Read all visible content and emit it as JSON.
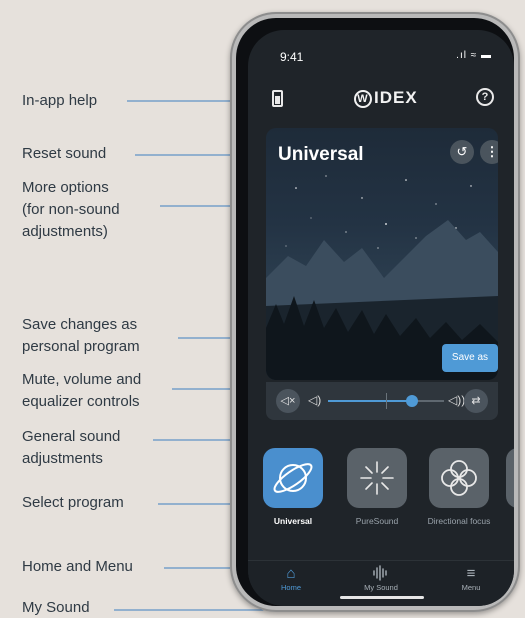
{
  "annotations": {
    "in_app_help": "In-app help",
    "reset_sound": "Reset sound",
    "more_options_1": "More options",
    "more_options_2": "(for non-sound",
    "more_options_3": "adjustments)",
    "save_changes_1": "Save changes as",
    "save_changes_2": "personal program",
    "mute_volume_1": "Mute, volume and",
    "mute_volume_2": "equalizer controls",
    "general_sound_1": "General sound",
    "general_sound_2": "adjustments",
    "select_program": "Select program",
    "home_menu": "Home and Menu",
    "my_sound": "My Sound"
  },
  "status_bar": {
    "time": "9:41",
    "signal": ".ıl ≈ ▬"
  },
  "app_bar": {
    "brand_mark": "W",
    "brand_text": "IDEX",
    "help_glyph": "?"
  },
  "program_card": {
    "title": "Universal",
    "reset_glyph": "↺",
    "more_glyph": "⋮",
    "save_label": "Save as"
  },
  "volume": {
    "mute_glyph": "◁×",
    "low_glyph": "◁)",
    "high_glyph": "◁))",
    "eq_glyph": "⇄",
    "level": 0.72
  },
  "programs": [
    {
      "label": "Universal",
      "active": true
    },
    {
      "label": "PureSound",
      "active": false
    },
    {
      "label": "Directional focus",
      "active": false
    }
  ],
  "nav": [
    {
      "label": "Home",
      "icon": "home-icon",
      "active": true
    },
    {
      "label": "My Sound",
      "icon": "sound-wave-icon",
      "active": false
    },
    {
      "label": "Menu",
      "icon": "menu-icon",
      "active": false
    }
  ],
  "colors": {
    "accent": "#4f9ad6",
    "annotation_line": "#3e7fc0"
  }
}
